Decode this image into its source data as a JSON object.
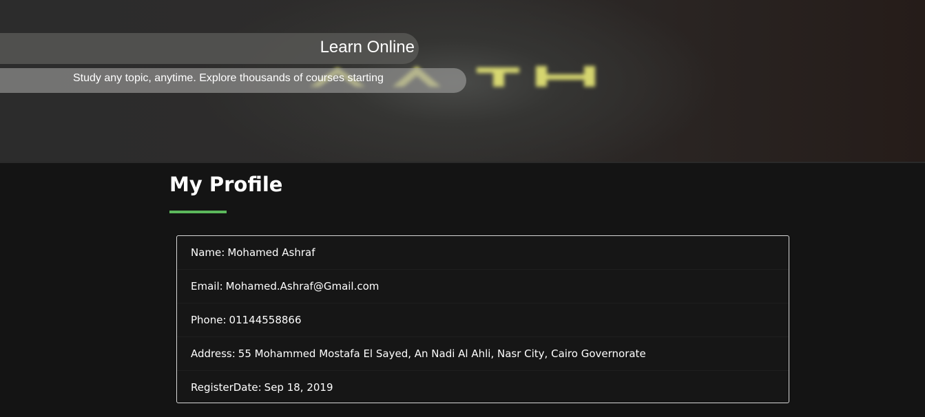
{
  "hero": {
    "title": "Learn Online",
    "subtitle": "Study any topic, anytime. Explore thousands of courses starting",
    "background_word_color": "#f5f56a"
  },
  "page": {
    "title": "My Profile",
    "accent_color": "#5cb85c"
  },
  "profile": {
    "name_label": "Name:",
    "name": "Mohamed Ashraf",
    "email_label": "Email:",
    "email": "Mohamed.Ashraf@Gmail.com",
    "phone_label": "Phone:",
    "phone": "01144558866",
    "address_label": "Address:",
    "address": "55 Mohammed Mostafa El Sayed, An Nadi Al Ahli, Nasr City, Cairo Governorate",
    "register_label": "RegisterDate:",
    "register_date": "Sep 18, 2019"
  }
}
